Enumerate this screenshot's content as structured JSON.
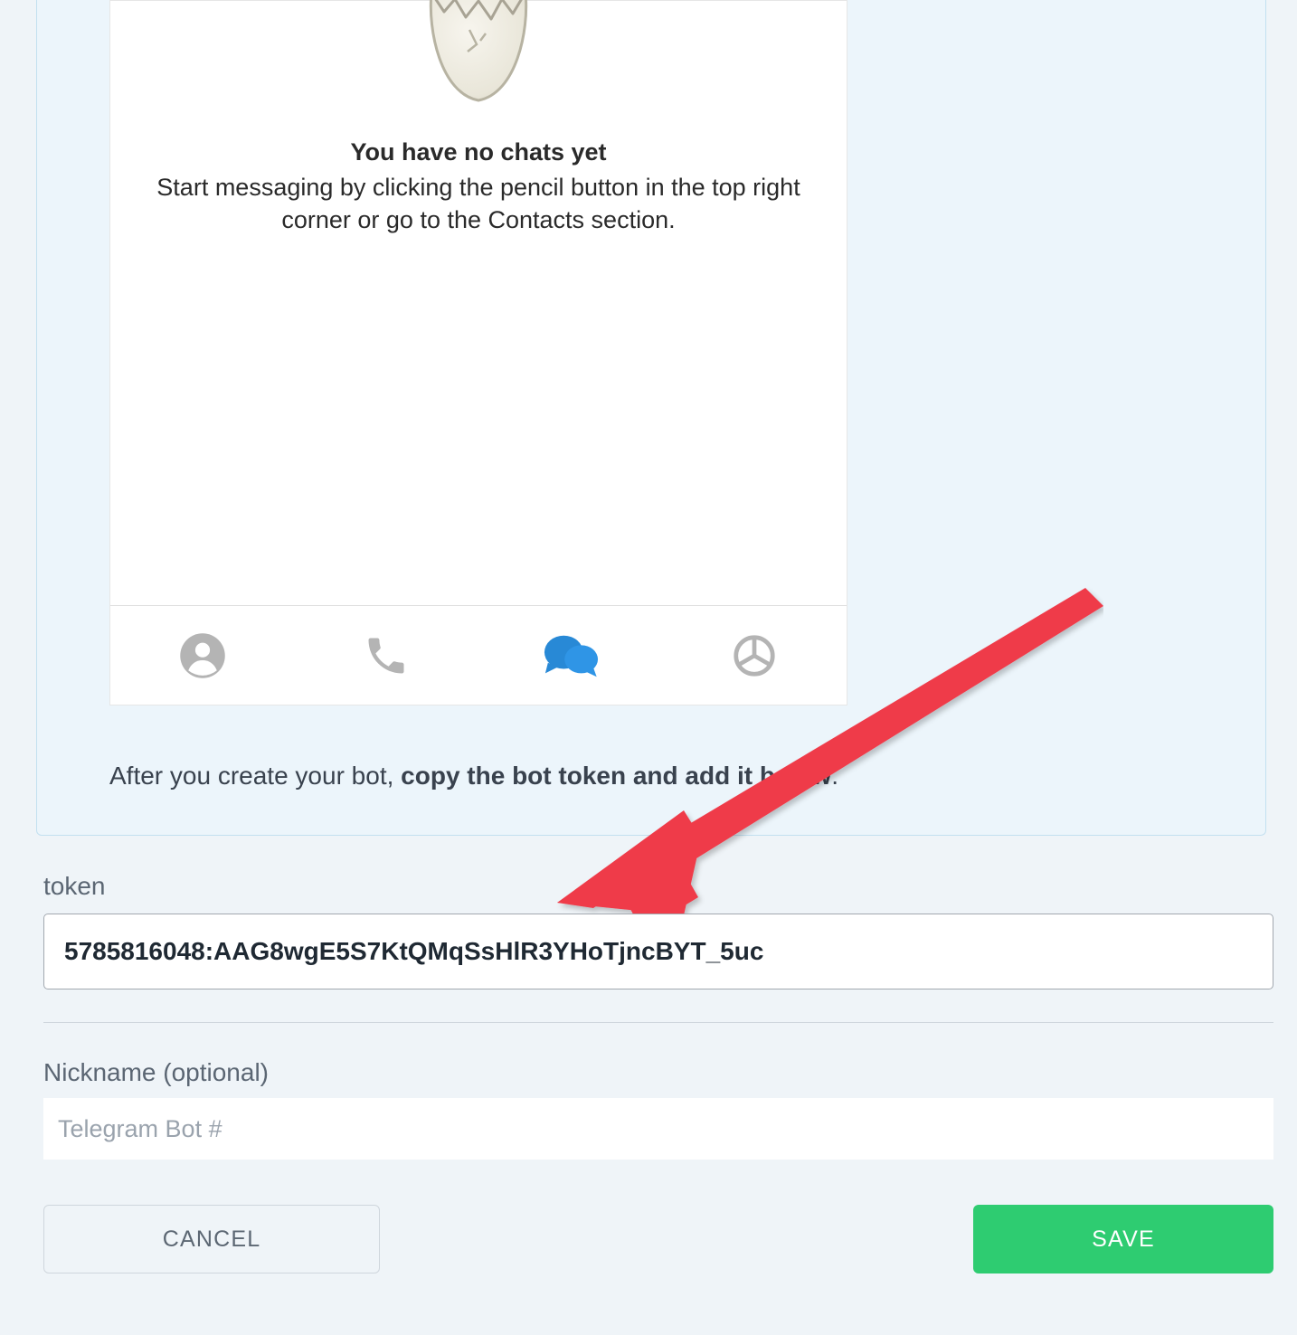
{
  "preview": {
    "empty_title": "You have no chats yet",
    "empty_subtitle": "Start messaging by clicking the pencil button in the top right corner or go to the Contacts section."
  },
  "instruction": {
    "prefix": "After you create your bot, ",
    "bold": "copy the bot token and add it below",
    "suffix": "."
  },
  "form": {
    "token_label": "token",
    "token_value": "5785816048:AAG8wgE5S7KtQMqSsHlR3YHoTjncBYT_5uc",
    "nickname_label": "Nickname (optional)",
    "nickname_placeholder": "Telegram Bot #",
    "cancel_label": "CANCEL",
    "save_label": "SAVE"
  },
  "tabs": [
    "contacts",
    "calls",
    "chats",
    "settings"
  ],
  "colors": {
    "accent_blue": "#2889d6",
    "save_green": "#2ecc71",
    "arrow_red": "#ef3b4a"
  }
}
